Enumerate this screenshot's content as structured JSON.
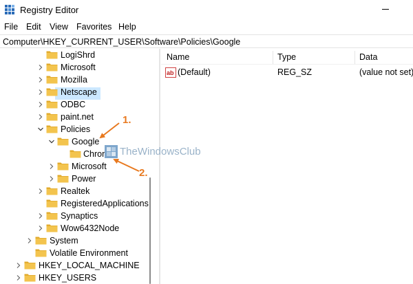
{
  "window": {
    "title": "Registry Editor"
  },
  "menu": {
    "items": [
      "File",
      "Edit",
      "View",
      "Favorites",
      "Help"
    ]
  },
  "address": {
    "path": "Computer\\HKEY_CURRENT_USER\\Software\\Policies\\Google"
  },
  "tree": {
    "items": [
      {
        "label": "LogiShrd"
      },
      {
        "label": "Microsoft"
      },
      {
        "label": "Mozilla"
      },
      {
        "label": "Netscape"
      },
      {
        "label": "ODBC"
      },
      {
        "label": "paint.net"
      },
      {
        "label": "Policies"
      },
      {
        "label": "Google"
      },
      {
        "label": "Chrome"
      },
      {
        "label": "Microsoft"
      },
      {
        "label": "Power"
      },
      {
        "label": "Realtek"
      },
      {
        "label": "RegisteredApplications"
      },
      {
        "label": "Synaptics"
      },
      {
        "label": "Wow6432Node"
      },
      {
        "label": "System"
      },
      {
        "label": "Volatile Environment"
      },
      {
        "label": "HKEY_LOCAL_MACHINE"
      },
      {
        "label": "HKEY_USERS"
      }
    ]
  },
  "list": {
    "columns": [
      "Name",
      "Type",
      "Data"
    ],
    "rows": [
      {
        "name": "(Default)",
        "type": "REG_SZ",
        "data": "(value not set)"
      }
    ]
  },
  "annotations": {
    "one": "1.",
    "two": "2."
  },
  "watermark": {
    "text": "TheWindowsClub"
  },
  "colors": {
    "selection": "#cce8ff",
    "annotation": "#e8791f",
    "folder": "#f3c44e",
    "folder_dark": "#e0a92a"
  }
}
